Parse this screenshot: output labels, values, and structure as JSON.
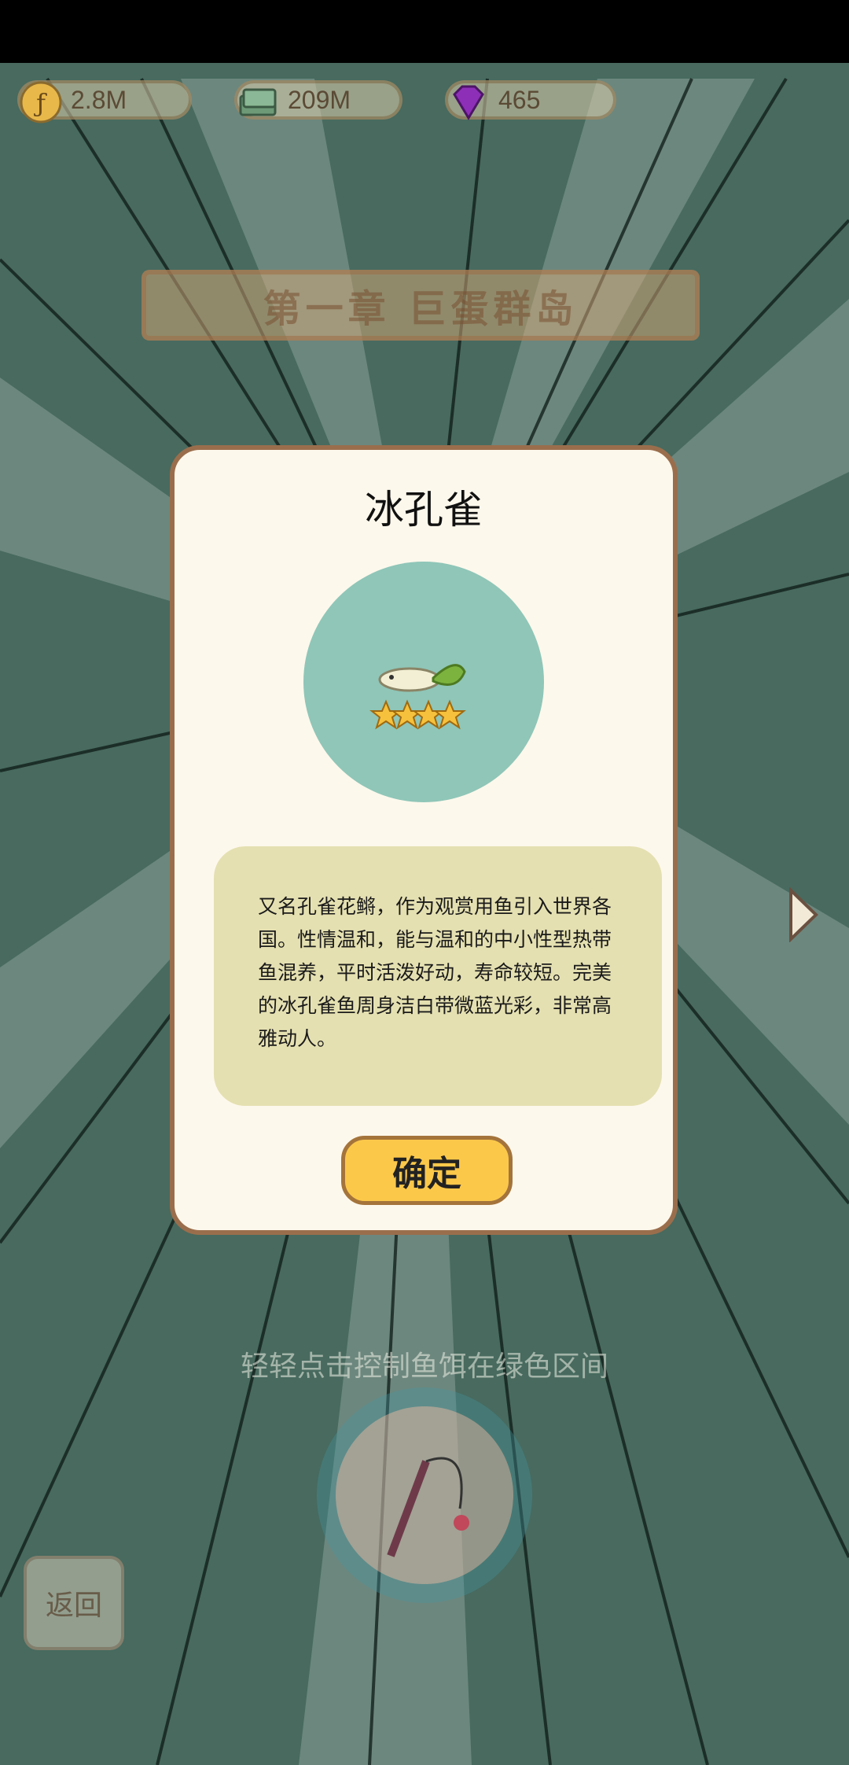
{
  "currency": {
    "coins": {
      "value": "2.8M",
      "icon": "coin-icon"
    },
    "cash": {
      "value": "209M",
      "icon": "cash-stack-icon"
    },
    "gems": {
      "value": "465",
      "icon": "gem-icon"
    }
  },
  "chapter": {
    "title": "第一章  巨蛋群岛"
  },
  "dialog": {
    "title": "冰孔雀",
    "stars": 4,
    "description": "又名孔雀花鳉，作为观赏用鱼引入世界各国。性情温和，能与温和的中小性型热带鱼混养，平时活泼好动，寿命较短。完美的冰孔雀鱼周身洁白带微蓝光彩，非常高雅动人。",
    "confirm_label": "确定"
  },
  "hint": "轻轻点击控制鱼饵在绿色区间",
  "back_label": "返回",
  "colors": {
    "dialog_bg": "#fdf8ec",
    "dialog_border": "#9a6e4c",
    "circle_bg": "#8fc6b8",
    "desc_bg": "#e5e0b1",
    "button_bg": "#fcc84a",
    "scene_bg": "#486a5f"
  }
}
